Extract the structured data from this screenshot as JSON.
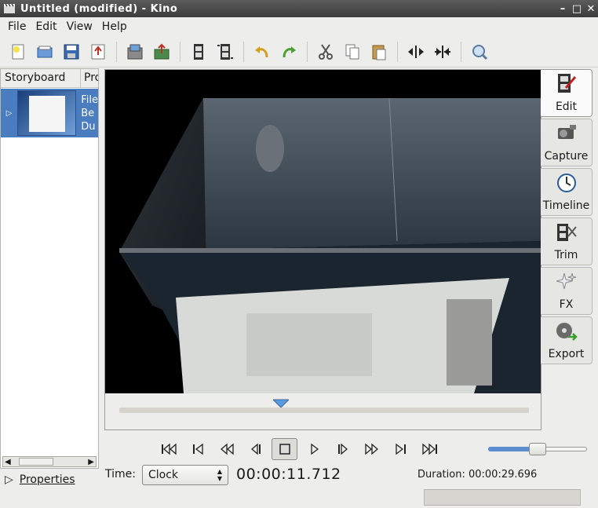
{
  "window": {
    "title": "Untitled (modified)  - Kino",
    "minimize_glyph": "–",
    "maximize_glyph": "□",
    "close_glyph": "✕"
  },
  "menubar": {
    "items": [
      "File",
      "Edit",
      "View",
      "Help"
    ]
  },
  "toolbar": {
    "buttons": [
      "new-file-icon",
      "open-icon",
      "save-icon",
      "export-still-icon",
      "save-frame-icon",
      "publish-icon",
      "insert-before-icon",
      "insert-after-icon",
      "undo-icon",
      "redo-icon",
      "cut-icon",
      "copy-icon",
      "paste-icon",
      "split-icon",
      "join-icon",
      "zoom-icon"
    ]
  },
  "storyboard": {
    "col_storyboard": "Storyboard",
    "col_props": "Pro",
    "rows": [
      {
        "text_lines": [
          "File",
          "Be",
          "Du"
        ]
      }
    ],
    "properties_label": "Properties"
  },
  "sidetabs": [
    {
      "label": "Edit",
      "icon": "edit-icon",
      "active": true
    },
    {
      "label": "Capture",
      "icon": "camcorder-icon",
      "active": false
    },
    {
      "label": "Timeline",
      "icon": "clock-icon",
      "active": false
    },
    {
      "label": "Trim",
      "icon": "trim-icon",
      "active": false
    },
    {
      "label": "FX",
      "icon": "fx-icon",
      "active": false
    },
    {
      "label": "Export",
      "icon": "export-icon",
      "active": false
    }
  ],
  "transport": {
    "buttons": [
      "first-scene-icon",
      "previous-scene-icon",
      "rewind-icon",
      "back-frame-icon",
      "stop-icon",
      "play-icon",
      "forward-frame-icon",
      "fast-forward-icon",
      "next-scene-icon",
      "last-scene-icon"
    ]
  },
  "volume": {
    "level": 0.5
  },
  "time": {
    "label": "Time:",
    "mode": "Clock",
    "current": "00:00:11.712",
    "duration_text": "Duration: 00:00:29.696"
  },
  "colors": {
    "titlebar": "#4a4a4a",
    "selection": "#4a7cc0",
    "accent": "#5a8ed0"
  }
}
